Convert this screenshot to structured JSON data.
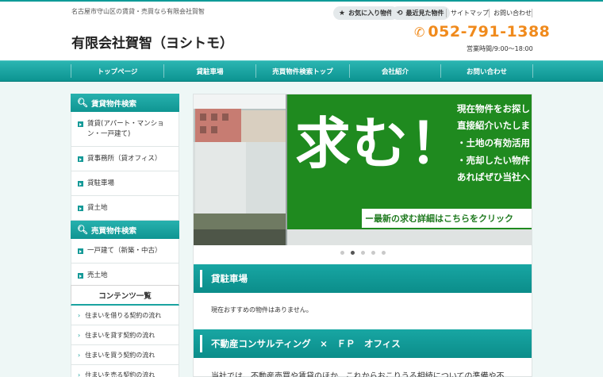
{
  "header": {
    "tagline": "名古屋市守山区の賃貸・売買なら有限会社賀智",
    "logo": "有限会社賀智（ヨシトモ）",
    "favorites_label": "お気に入り物件",
    "recent_label": "最近見た物件",
    "sitemap_label": "サイトマップ",
    "contact_label": "お問い合わせ",
    "phone": "052-791-1388",
    "hours": "営業時間/9:00～18:00"
  },
  "nav": {
    "items": [
      "トップページ",
      "貸駐車場",
      "売買物件検索トップ",
      "会社紹介",
      "お問い合わせ"
    ]
  },
  "sidebar": {
    "rental_title": "賃貸物件検索",
    "rental_items": [
      "賃貸(アパート・マンション・一戸建て)",
      "貸事務所（貸オフィス）",
      "貸駐車場",
      "貸土地"
    ],
    "sale_title": "売買物件検索",
    "sale_items": [
      "一戸建て（新築・中古）",
      "売土地"
    ],
    "contents_title": "コンテンツ一覧",
    "contents_items": [
      "住まいを借りる契約の流れ",
      "住まいを貸す契約の流れ",
      "住まいを買う契約の流れ",
      "住まいを売る契約の流れ"
    ]
  },
  "slider": {
    "big_text": "求む！",
    "lines": [
      "現在物件をお探し",
      "直接紹介いたしま",
      "・土地の有効活用",
      "・売却したい物件",
      "あればぜひ当社へ"
    ],
    "banner_link": "ー最新の求む詳細はこちらをクリック",
    "dot_count": 5,
    "active_dot": 1
  },
  "sections": {
    "parking_title": "貸駐車場",
    "parking_notice": "現在おすすめの物件はありません。",
    "consulting_title": "不動産コンサルティング　×　ＦＰ　オフィス",
    "consulting_text": "当社では、不動産売買や賃貸のほか、これからおこりうる相続についての準備や不"
  },
  "colors": {
    "teal": "#0f9b98",
    "orange": "#f08a1c",
    "slide_green": "#1f8a1f"
  }
}
